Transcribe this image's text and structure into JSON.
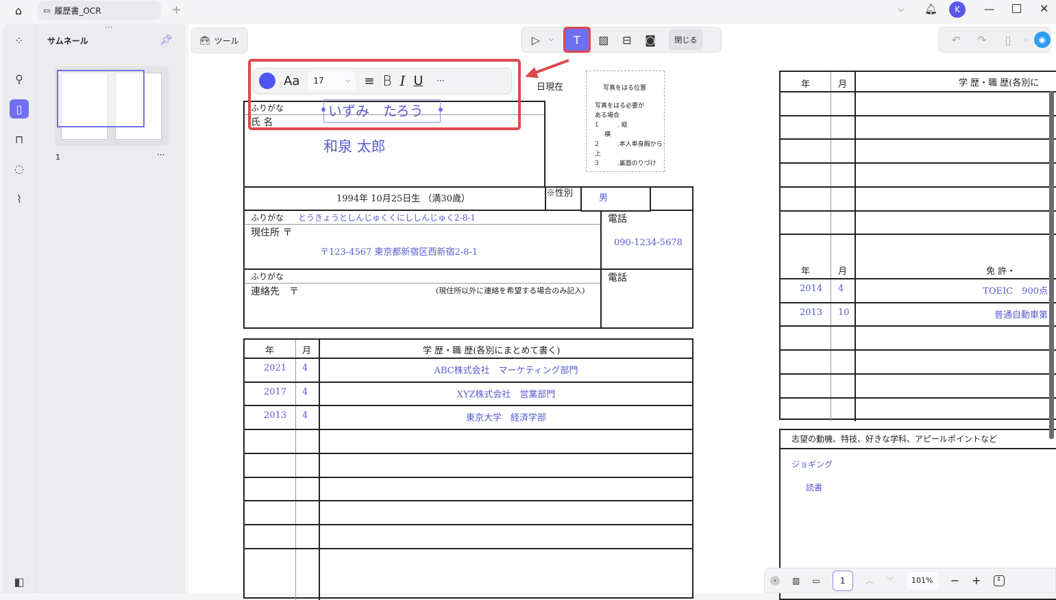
{
  "tab": {
    "title": "履歴書_OCR"
  },
  "panel": {
    "title": "サムネール",
    "page_number": "1",
    "more": "···"
  },
  "toolbar": {
    "tools_label": "ツール",
    "close_label": "閉じる"
  },
  "text_format": {
    "color": "#4f55f0",
    "font_label": "Aa",
    "font_size": "17",
    "bold": "B",
    "italic": "I",
    "underline": "U",
    "more": "···"
  },
  "document": {
    "date_suffix": "日現在",
    "photo": {
      "title": "写真をはる位置",
      "line1": "写真をはる必要が",
      "line2": "ある場合",
      "line3": "1　　　.  縦",
      "line4": "横",
      "line5": "2　　　.本人単身胸から上",
      "line6": "3　　　.裏面のりづけ"
    },
    "furigana_label": "ふりがな",
    "name_label": "氏 名",
    "furigana_value": "いずみ　たろう",
    "name_value": "和泉 太郎",
    "birth": "1994年 10月25日生 （満30歳）",
    "gender_label": "※性別",
    "gender_value": "男",
    "address_furigana": "とうきょうとしんじゅくくにししんじゅく2-8-1",
    "address_label": "現住所 〒",
    "address_value": "〒123-4567 東京都新宿区西新宿2-8-1",
    "phone_label": "電話",
    "phone_value": "090-1234-5678",
    "contact_furigana_label": "ふりがな",
    "contact_label": "連絡先　〒",
    "contact_note": "(現住所以外に連絡を希望する場合のみ記入)",
    "contact_phone_label": "電話",
    "history_header": {
      "year": "年",
      "month": "月",
      "content": "学 歴・職 歴(各別にまとめて書く)"
    },
    "history_rows": [
      {
        "year": "2021",
        "month": "4",
        "content": "ABC株式会社　マーケティング部門"
      },
      {
        "year": "2017",
        "month": "4",
        "content": "XYZ株式会社　営業部門"
      },
      {
        "year": "2013",
        "month": "4",
        "content": "東京大学　経済学部"
      },
      {
        "year": "",
        "month": "",
        "content": ""
      },
      {
        "year": "",
        "month": "",
        "content": ""
      },
      {
        "year": "",
        "month": "",
        "content": ""
      },
      {
        "year": "",
        "month": "",
        "content": ""
      },
      {
        "year": "",
        "month": "",
        "content": ""
      },
      {
        "year": "",
        "month": "",
        "content": ""
      }
    ],
    "right_header": {
      "year": "年",
      "month": "月",
      "content": "学 歴・職 歴(各別に"
    },
    "license_header": {
      "year": "年",
      "month": "月",
      "content": "免 許・"
    },
    "license_rows": [
      {
        "year": "2014",
        "month": "4",
        "content": "TOEIC　900点"
      },
      {
        "year": "2013",
        "month": "10",
        "content": "普通自動車第"
      },
      {
        "year": "",
        "month": "",
        "content": ""
      },
      {
        "year": "",
        "month": "",
        "content": ""
      },
      {
        "year": "",
        "month": "",
        "content": ""
      },
      {
        "year": "",
        "month": "",
        "content": ""
      }
    ],
    "motivation_header": "志望の動機、特技、好きな学科、アピールポイントなど",
    "motivation_items": [
      "ジョギング",
      "読書"
    ]
  },
  "bottom": {
    "page": "1",
    "zoom": "101%"
  },
  "user": {
    "initial": "K"
  }
}
